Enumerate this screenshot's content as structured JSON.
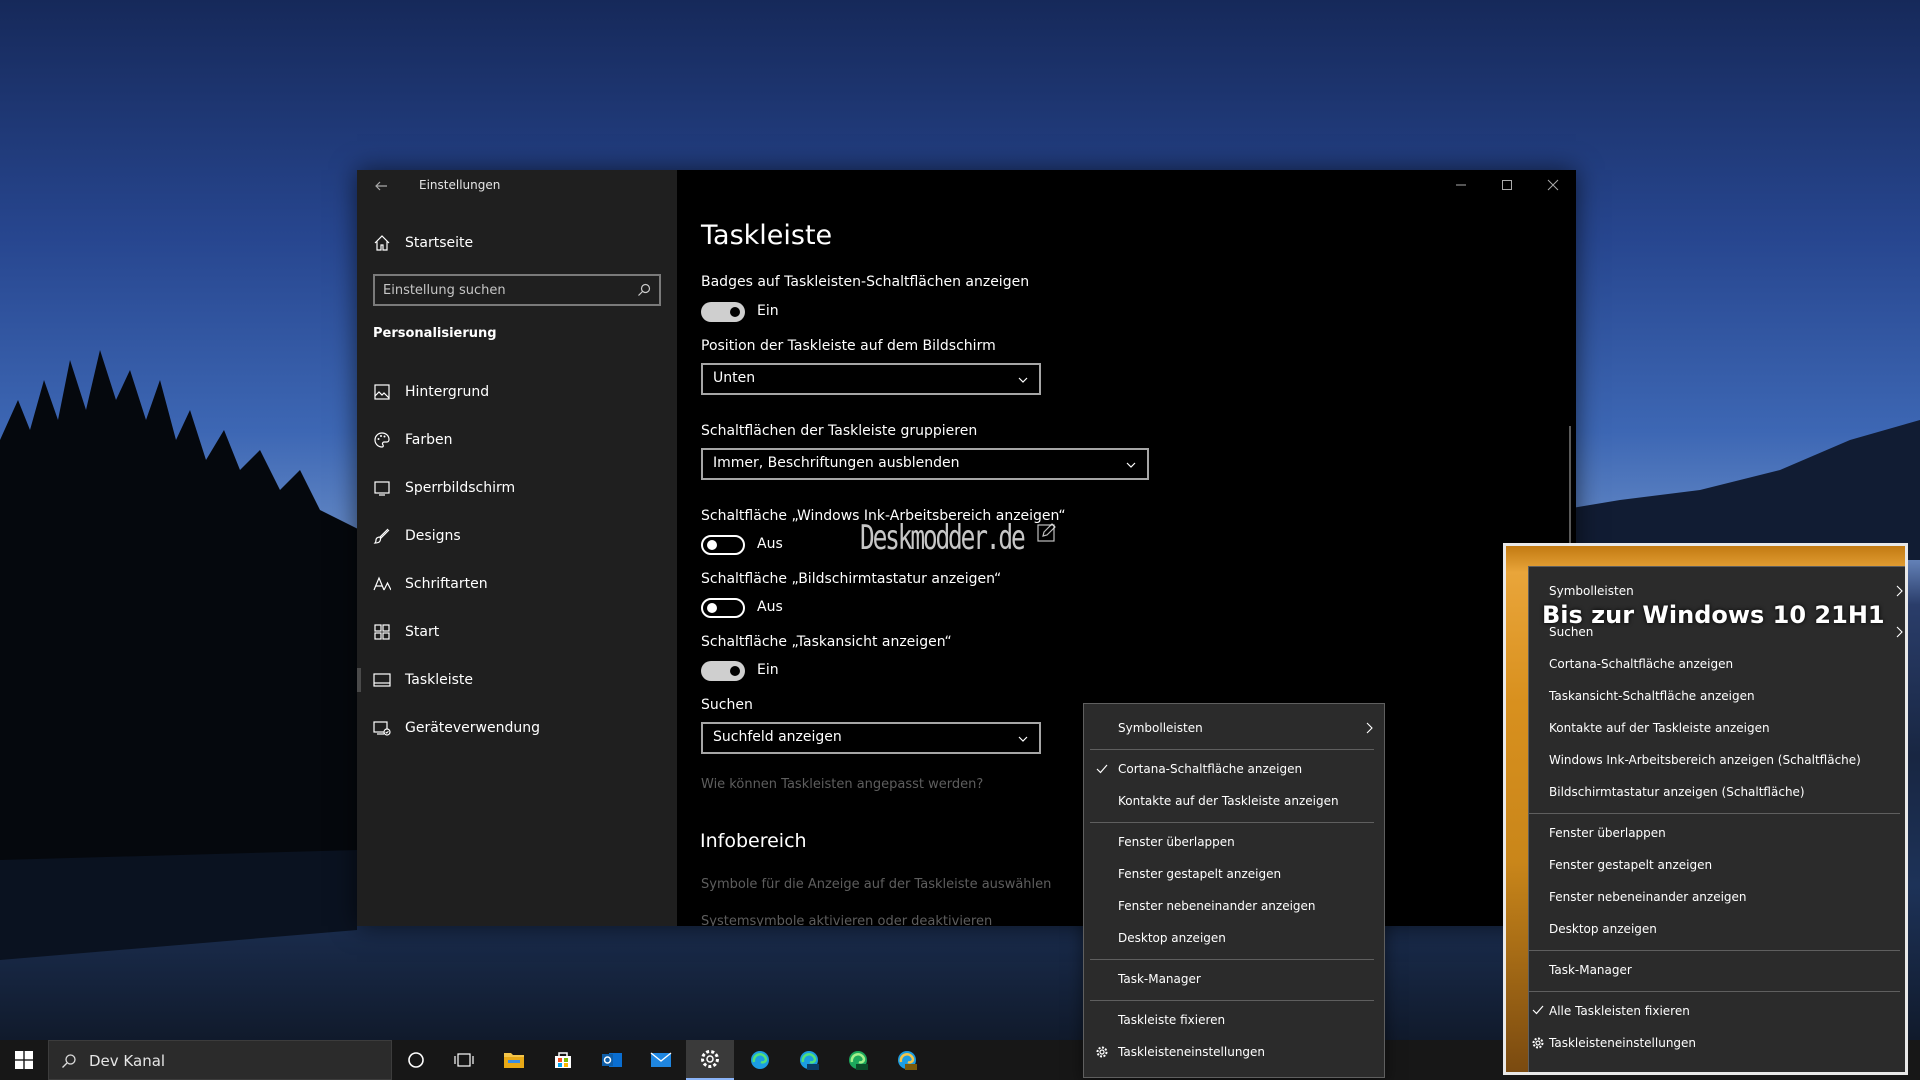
{
  "window": {
    "title": "Einstellungen"
  },
  "sidebar": {
    "home_label": "Startseite",
    "search_placeholder": "Einstellung suchen",
    "section_heading": "Personalisierung",
    "items": [
      {
        "label": "Hintergrund",
        "icon": "image-icon"
      },
      {
        "label": "Farben",
        "icon": "palette-icon"
      },
      {
        "label": "Sperrbildschirm",
        "icon": "lock-screen-icon"
      },
      {
        "label": "Designs",
        "icon": "brush-icon"
      },
      {
        "label": "Schriftarten",
        "icon": "font-icon"
      },
      {
        "label": "Start",
        "icon": "start-icon"
      },
      {
        "label": "Taskleiste",
        "icon": "taskbar-icon"
      },
      {
        "label": "Geräteverwendung",
        "icon": "device-usage-icon"
      }
    ],
    "active_item": "Taskleiste"
  },
  "main": {
    "title": "Taskleiste",
    "badges": {
      "label": "Badges auf Taskleisten-Schaltflächen anzeigen",
      "state": "Ein"
    },
    "position": {
      "label": "Position der Taskleiste auf dem Bildschirm",
      "value": "Unten"
    },
    "grouping": {
      "label": "Schaltflächen der Taskleiste gruppieren",
      "value": "Immer, Beschriftungen ausblenden"
    },
    "ink": {
      "label": "Schaltfläche „Windows Ink-Arbeitsbereich anzeigen“",
      "state": "Aus"
    },
    "keyboard": {
      "label": "Schaltfläche „Bildschirmtastatur anzeigen“",
      "state": "Aus"
    },
    "taskview": {
      "label": "Schaltfläche „Taskansicht anzeigen“",
      "state": "Ein"
    },
    "search": {
      "label": "Suchen",
      "value": "Suchfeld anzeigen"
    },
    "help_link": "Wie können Taskleisten angepasst werden?",
    "infobereich": {
      "title": "Infobereich",
      "link1": "Symbole für die Anzeige auf der Taskleiste auswählen",
      "link2": "Systemsymbole aktivieren oder deaktivieren"
    }
  },
  "watermark": "Deskmodder.de",
  "context_menu": {
    "items": {
      "symbolleisten": "Symbolleisten",
      "cortana": "Cortana-Schaltfläche anzeigen",
      "kontakte": "Kontakte auf der Taskleiste anzeigen",
      "ueberlappen": "Fenster überlappen",
      "gestapelt": "Fenster gestapelt anzeigen",
      "nebeneinander": "Fenster nebeneinander anzeigen",
      "desktop": "Desktop anzeigen",
      "taskmanager": "Task-Manager",
      "fixieren": "Taskleiste fixieren",
      "einstellungen": "Taskleisteneinstellungen"
    }
  },
  "old_menu": {
    "overlay_text": "Bis zur Windows 10 21H1",
    "items": {
      "symbolleisten": "Symbolleisten",
      "suchen": "Suchen",
      "cortana": "Cortana-Schaltfläche anzeigen",
      "taskansicht": "Taskansicht-Schaltfläche anzeigen",
      "kontakte": "Kontakte auf der Taskleiste anzeigen",
      "ink": "Windows Ink-Arbeitsbereich anzeigen (Schaltfläche)",
      "tastatur": "Bildschirmtastatur anzeigen (Schaltfläche)",
      "ueberlappen": "Fenster überlappen",
      "gestapelt": "Fenster gestapelt anzeigen",
      "nebeneinander": "Fenster nebeneinander anzeigen",
      "desktop": "Desktop anzeigen",
      "taskmanager": "Task-Manager",
      "fixieren": "Alle Taskleisten fixieren",
      "einstellungen": "Taskleisteneinstellungen"
    }
  },
  "taskbar": {
    "search_text": "Dev Kanal",
    "icons": [
      "windows-start-icon",
      "cortana-icon",
      "task-view-icon",
      "file-explorer-icon",
      "store-icon",
      "outlook-icon",
      "mail-icon",
      "settings-gear-icon",
      "edge-icon",
      "edge-beta-icon",
      "edge-dev-icon",
      "edge-canary-icon"
    ]
  }
}
